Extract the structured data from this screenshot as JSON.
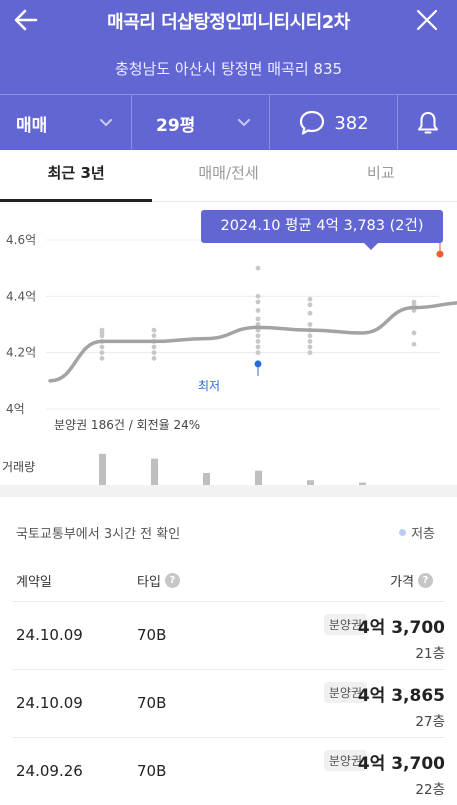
{
  "header": {
    "title": "매곡리 더샵탕정인피니티시티2차",
    "address": "충청남도 아산시 탕정면 매곡리 835",
    "back_icon": "arrow-left-icon",
    "close_icon": "close-icon",
    "background": "#6266d3"
  },
  "filters": {
    "deal_type": "매매",
    "size": "29평",
    "comment_count": "382",
    "comment_icon": "speech-bubble-icon",
    "bell_icon": "bell-icon"
  },
  "tabs": [
    {
      "label": "최근 3년",
      "active": true
    },
    {
      "label": "매매/전세",
      "active": false
    },
    {
      "label": "비교",
      "active": false
    }
  ],
  "chart": {
    "tooltip": "2024.10 평균 4억 3,783 (2건)",
    "low_label": "최저",
    "sales_note": "분양권 186건 / 회전율 24%",
    "volume_label": "거래량"
  },
  "chart_data": {
    "type": "line",
    "y_unit": "억",
    "ylim": [
      4.0,
      4.6
    ],
    "ytick_labels": [
      "4.6억",
      "4.4억",
      "4.2억",
      "4억"
    ],
    "yticks": [
      4.6,
      4.4,
      4.2,
      4.0
    ],
    "trend": {
      "x": [
        0,
        1,
        2,
        3,
        4,
        5,
        6,
        7,
        8
      ],
      "values": [
        4.1,
        4.24,
        4.24,
        4.25,
        4.29,
        4.28,
        4.27,
        4.36,
        4.378
      ]
    },
    "latest_point": {
      "x": 8,
      "value": 4.378,
      "label": "2024.10 평균 4억 3,783 (2건)"
    },
    "max_point": {
      "x": 7.5,
      "value": 4.55
    },
    "min_point": {
      "x": 4,
      "value": 4.16
    },
    "scatter_groups": [
      {
        "x": 1,
        "values": [
          4.18,
          4.2,
          4.22,
          4.24,
          4.26,
          4.27,
          4.28
        ]
      },
      {
        "x": 2,
        "values": [
          4.18,
          4.2,
          4.22,
          4.24,
          4.26,
          4.28
        ]
      },
      {
        "x": 4,
        "values": [
          4.2,
          4.22,
          4.24,
          4.26,
          4.28,
          4.3,
          4.32,
          4.35,
          4.38,
          4.4,
          4.5
        ]
      },
      {
        "x": 5,
        "values": [
          4.2,
          4.22,
          4.24,
          4.26,
          4.28,
          4.3,
          4.34,
          4.37,
          4.39
        ]
      },
      {
        "x": 7,
        "values": [
          4.23,
          4.27,
          4.35,
          4.37,
          4.38
        ]
      }
    ],
    "volume": [
      {
        "x": 1,
        "value": 13
      },
      {
        "x": 2,
        "value": 11
      },
      {
        "x": 3,
        "value": 5
      },
      {
        "x": 4,
        "value": 6
      },
      {
        "x": 5,
        "value": 2
      },
      {
        "x": 6,
        "value": 1
      }
    ],
    "colors": {
      "trend": "#a3a3a3",
      "latest": "#4b4fd6",
      "max": "#ef5d2d",
      "min": "#2a6ad9",
      "scatter": "#c8c8c8",
      "volume": "#bfbfbf"
    }
  },
  "transactions": {
    "source_text": "국토교통부에서 3시간 전 확인",
    "legend": "저층",
    "legend_color": "#b9cdf0",
    "columns": {
      "date": "계약일",
      "type": "타입",
      "price": "가격"
    },
    "rows": [
      {
        "date": "24.10.09",
        "type": "70B",
        "badge": "분양권",
        "price": "4억 3,700",
        "floor": "21층"
      },
      {
        "date": "24.10.09",
        "type": "70B",
        "badge": "분양권",
        "price": "4억 3,865",
        "floor": "27층"
      },
      {
        "date": "24.09.26",
        "type": "70B",
        "badge": "분양권",
        "price": "4억 3,700",
        "floor": "22층"
      }
    ]
  }
}
